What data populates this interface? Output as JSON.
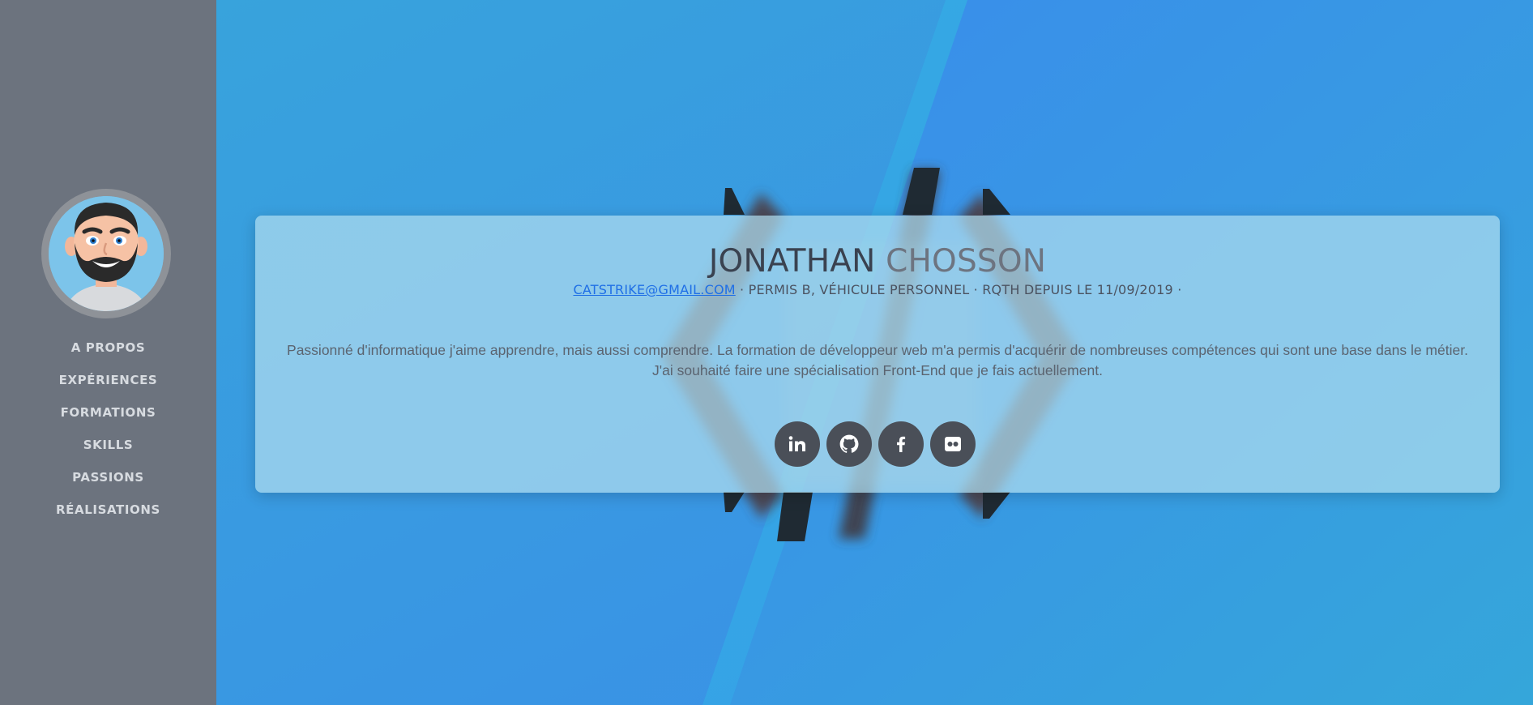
{
  "profile": {
    "first_name": "JONATHAN",
    "last_name": "CHOSSON",
    "email": "CATSTRIKE@GMAIL.COM",
    "details": " · PERMIS B, VÉHICULE PERSONNEL · RQTH DEPUIS LE 11/09/2019 ·",
    "bio": "Passionné d'informatique j'aime apprendre, mais aussi comprendre. La formation de développeur web m'a permis d'acquérir de nombreuses compétences qui sont une base dans le métier. J'ai souhaité faire une spécialisation Front-End que je fais actuellement."
  },
  "sidebar": {
    "avatar_icon": "bearded-man-avatar",
    "items": [
      {
        "label": "A PROPOS"
      },
      {
        "label": "EXPÉRIENCES"
      },
      {
        "label": "FORMATIONS"
      },
      {
        "label": "SKILLS"
      },
      {
        "label": "PASSIONS"
      },
      {
        "label": "RÉALISATIONS"
      }
    ]
  },
  "socials": [
    {
      "icon": "linkedin-icon"
    },
    {
      "icon": "github-icon"
    },
    {
      "icon": "facebook-icon"
    },
    {
      "icon": "flickr-icon"
    }
  ],
  "colors": {
    "sidebar_bg": "#6c737e",
    "hero_blue": "#3a8ee8",
    "hero_cyan": "#33a5dd",
    "link": "#1f6fe6",
    "social_bg": "#4a4f58"
  }
}
